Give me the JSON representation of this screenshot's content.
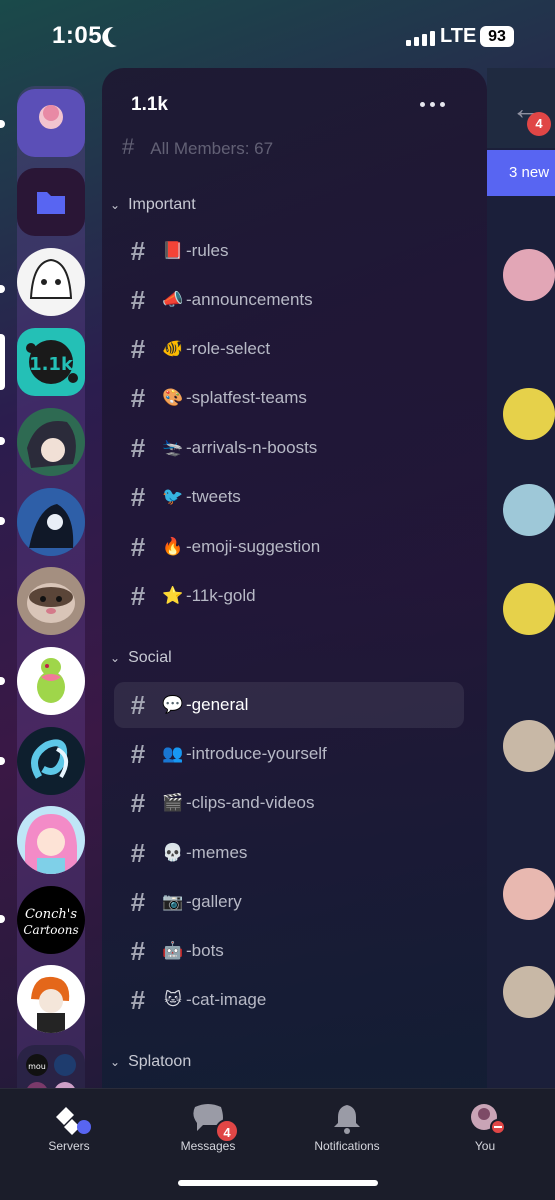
{
  "status_bar": {
    "time": "1:05",
    "network": "LTE",
    "battery": "93"
  },
  "server": {
    "name": "1.1k",
    "faded_item": "All Members: 67",
    "categories": [
      {
        "name": "Important",
        "channels": [
          {
            "emoji": "📕",
            "name": "-rules"
          },
          {
            "emoji": "📣",
            "name": "-announcements"
          },
          {
            "emoji": "🐠",
            "name": "-role-select"
          },
          {
            "emoji": "🎨",
            "name": "-splatfest-teams"
          },
          {
            "emoji": "🛬",
            "name": "-arrivals-n-boosts"
          },
          {
            "emoji": "🐦",
            "name": "-tweets"
          },
          {
            "emoji": "🔥",
            "name": "-emoji-suggestion"
          },
          {
            "emoji": "⭐",
            "name": "-11k-gold"
          }
        ]
      },
      {
        "name": "Social",
        "channels": [
          {
            "emoji": "💬",
            "name": "-general",
            "selected": true
          },
          {
            "emoji": "👥",
            "name": "-introduce-yourself"
          },
          {
            "emoji": "🎬",
            "name": "-clips-and-videos"
          },
          {
            "emoji": "💀",
            "name": "-memes"
          },
          {
            "emoji": "📷",
            "name": "-gallery"
          },
          {
            "emoji": "🤖",
            "name": "-bots"
          },
          {
            "emoji": "🐱",
            "name": "-cat-image"
          }
        ]
      },
      {
        "name": "Splatoon",
        "channels": []
      }
    ]
  },
  "server_icons": {
    "label_1_1k": "1.1k",
    "conch_text_1": "Conch's",
    "conch_text_2": "Cartoons",
    "folder_mini": "mou"
  },
  "peek": {
    "badge": "4",
    "new_banner": "3 new"
  },
  "bottom_nav": {
    "servers": "Servers",
    "messages": "Messages",
    "messages_badge": "4",
    "notifications": "Notifications",
    "you": "You"
  },
  "colors": {
    "accent": "#5865f2",
    "badge": "#e04646",
    "dnd": "#e04646"
  }
}
